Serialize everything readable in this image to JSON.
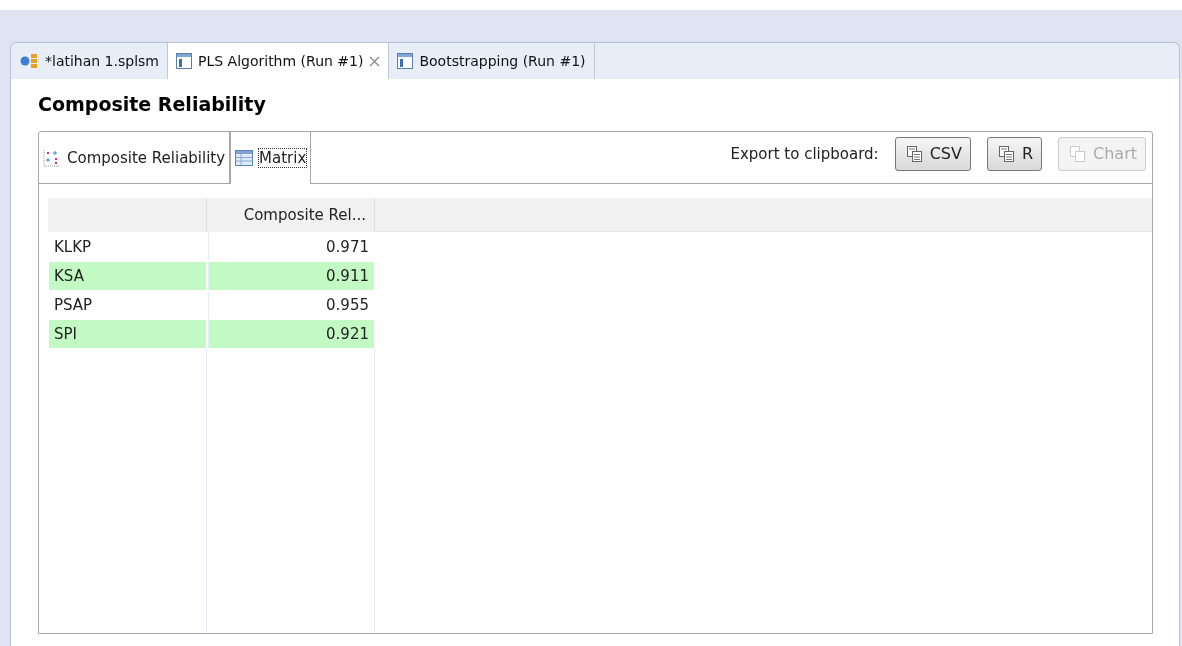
{
  "editor_tabs": [
    {
      "label": "*latihan 1.splsm",
      "kind": "model",
      "selected": false,
      "closable": false
    },
    {
      "label": "PLS Algorithm (Run #1)",
      "kind": "report",
      "selected": true,
      "closable": true
    },
    {
      "label": "Bootstrapping (Run #1)",
      "kind": "report",
      "selected": false,
      "closable": false
    }
  ],
  "title": "Composite Reliability",
  "view_tabs": [
    {
      "label": "Composite Reliability",
      "kind": "chart",
      "selected": false
    },
    {
      "label": "Matrix",
      "kind": "matrix",
      "selected": true
    }
  ],
  "export": {
    "label": "Export to clipboard:",
    "buttons": [
      {
        "label": "CSV",
        "disabled": false
      },
      {
        "label": "R",
        "disabled": false
      },
      {
        "label": "Chart",
        "disabled": true
      }
    ]
  },
  "table": {
    "columns": [
      "Composite Rel..."
    ],
    "rows": [
      {
        "name": "KLKP",
        "value": "0.971",
        "highlighted": false
      },
      {
        "name": "KSA",
        "value": "0.911",
        "highlighted": true
      },
      {
        "name": "PSAP",
        "value": "0.955",
        "highlighted": false
      },
      {
        "name": "SPI",
        "value": "0.921",
        "highlighted": true
      }
    ]
  }
}
